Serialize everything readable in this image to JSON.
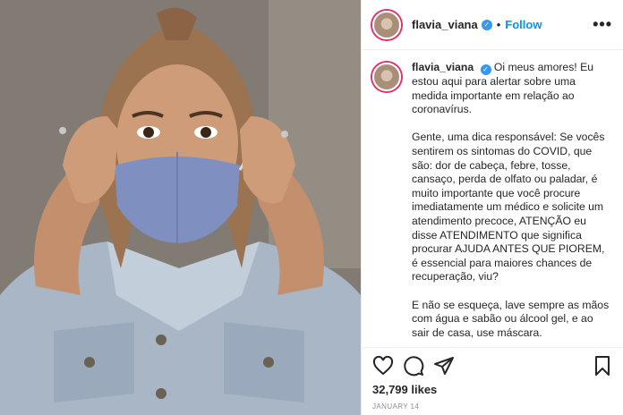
{
  "post": {
    "username": "flavia_viana",
    "verified_icon": "verified-badge-icon",
    "separator": "•",
    "follow_label": "Follow",
    "more_label": "•••",
    "caption": {
      "username": "flavia_viana",
      "paragraph_1": "Oi meus amores! Eu estou aqui para alertar sobre uma medida importante em relação ao coronavírus.",
      "paragraph_2": "Gente, uma dica responsável: Se vocês sentirem os sintomas do COVID, que são: dor de cabeça, febre, tosse, cansaço, perda de olfato ou paladar, é muito importante que você procure imediatamente um médico e solicite um atendimento precoce, ATENÇÃO eu disse ATENDIMENTO que significa procurar AJUDA ANTES QUE PIOREM, é essencial para maiores chances de recuperação, viu?",
      "paragraph_3": "E não se esqueça, lave sempre as mãos com água e sabão ou álcool gel, e ao sair de casa, use máscara."
    },
    "actions": [
      "heart-icon",
      "comment-icon",
      "share-icon",
      "bookmark-icon"
    ],
    "likes": "32,799 likes",
    "date": "JANUARY 14"
  },
  "colors": {
    "follow_blue": "#0095f6",
    "verified_blue": "#3897f0",
    "mask_blue": "#7f8fc0",
    "denim": "#a9b7c7"
  }
}
